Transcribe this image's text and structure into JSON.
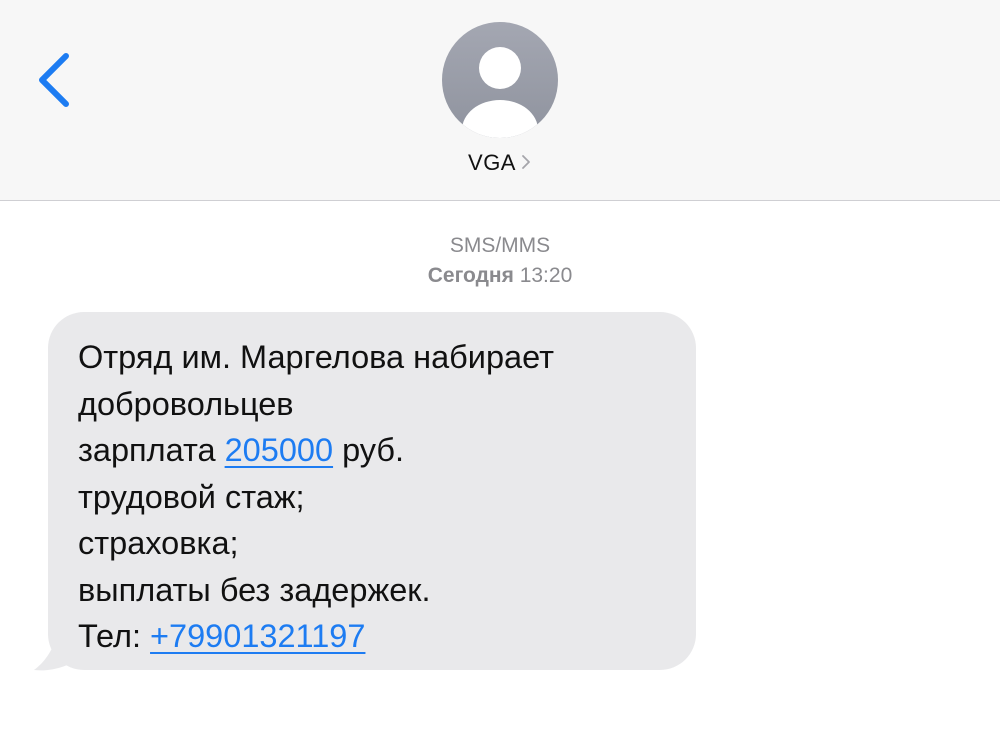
{
  "header": {
    "back_icon": "chevron-left-icon",
    "avatar_icon": "person-icon",
    "contact_name": "VGA",
    "contact_chevron_icon": "chevron-right-icon"
  },
  "thread": {
    "service_label": "SMS/MMS",
    "date_label": "Сегодня",
    "time_label": "13:20"
  },
  "message": {
    "line1": "Отряд им. Маргелова набирает",
    "line2": "добровольцев",
    "line3_prefix": "зарплата ",
    "line3_link": "205000",
    "line3_suffix": " руб.",
    "line4": "трудовой стаж;",
    "line5": "страховка;",
    "line6": "выплаты без задержек.",
    "line7_prefix": "Тел: ",
    "line7_link": "+79901321197"
  },
  "colors": {
    "accent": "#1d7cf2",
    "bubble": "#e9e9eb",
    "header_bg": "#f7f7f7",
    "meta_text": "#8a8a8e",
    "avatar": "#9a9da8"
  }
}
